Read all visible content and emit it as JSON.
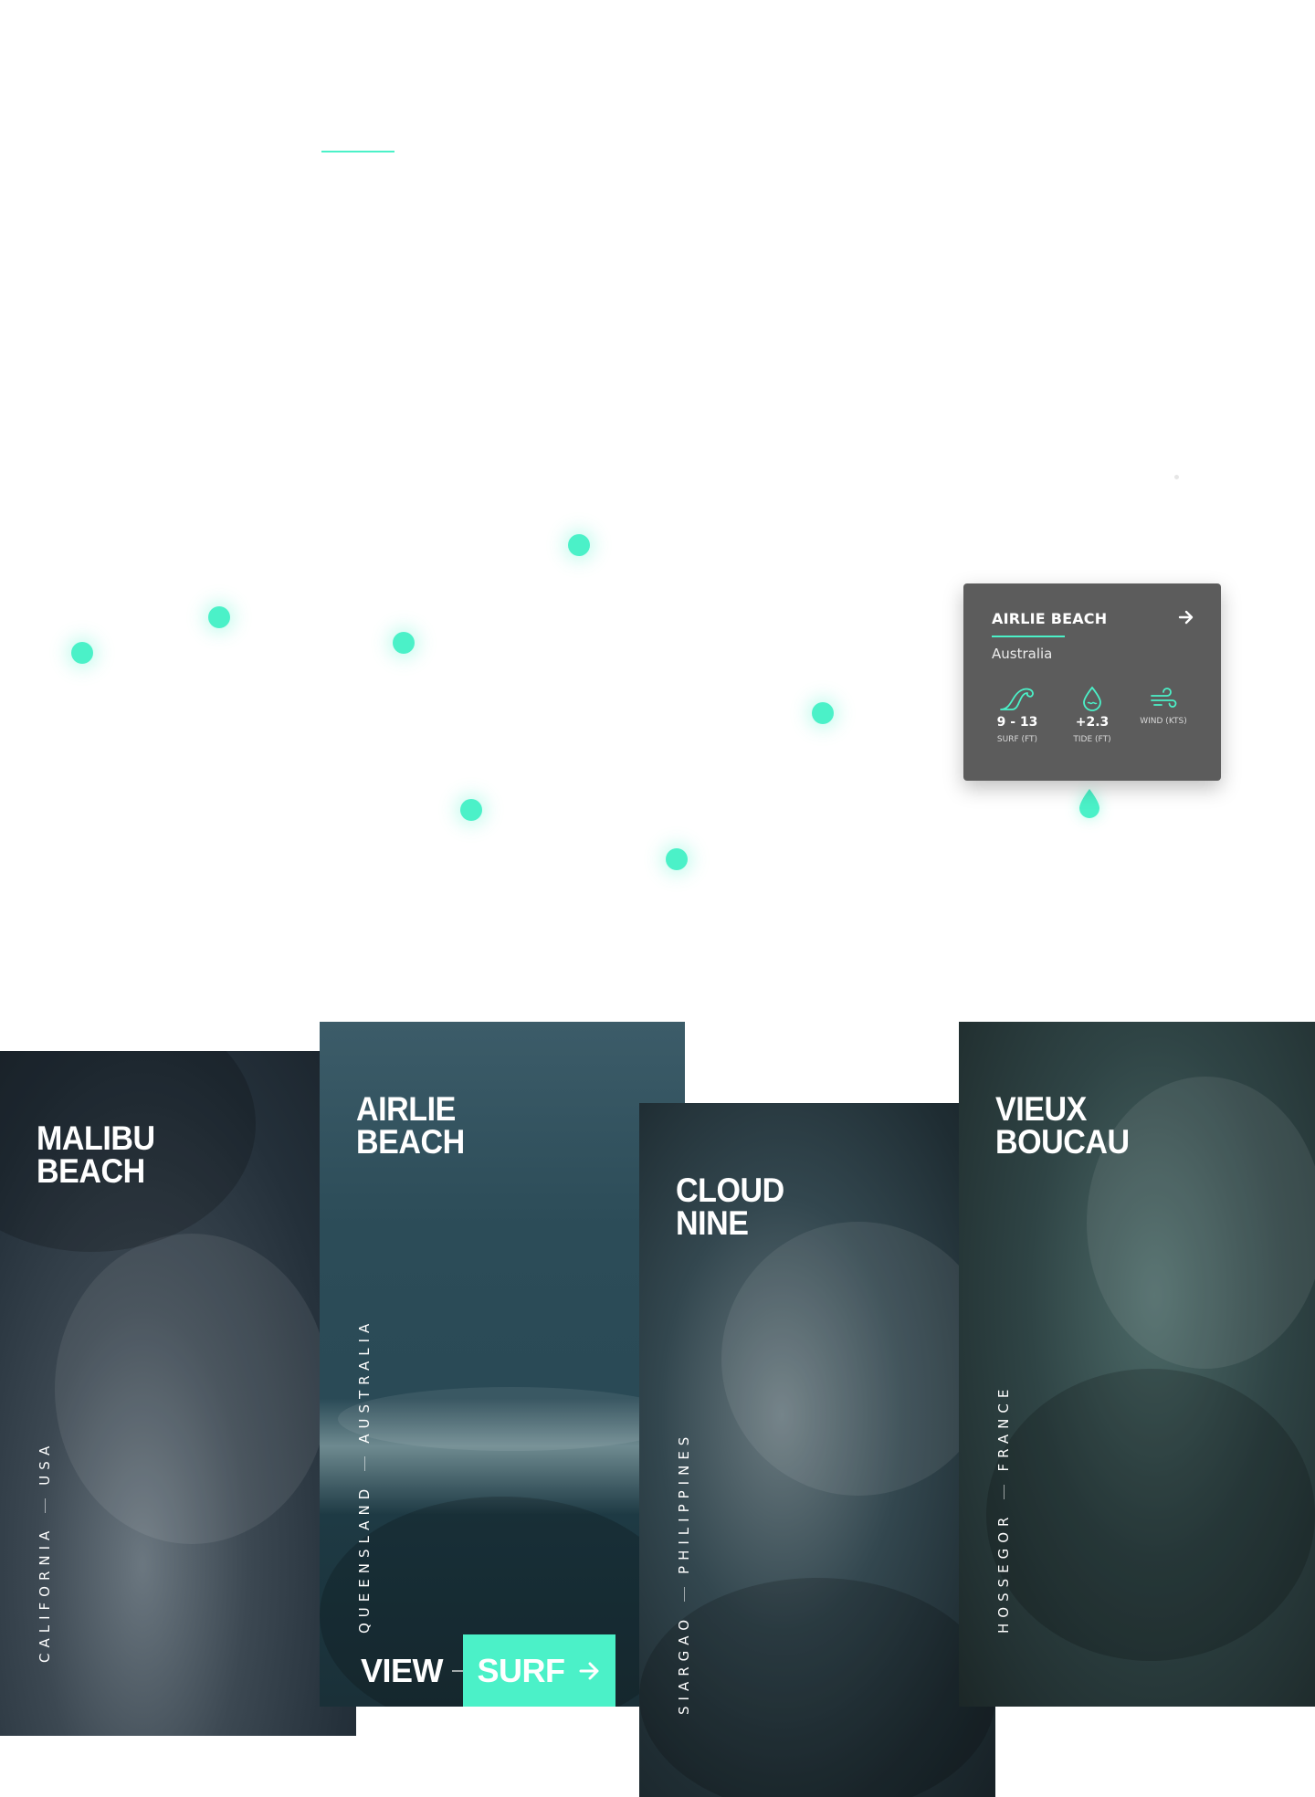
{
  "popup": {
    "title": "AIRLIE BEACH",
    "country": "Australia",
    "stats": [
      {
        "icon": "wave-icon",
        "value": "9 - 13",
        "label": "SURF (FT)"
      },
      {
        "icon": "water-drop-icon",
        "value": "+2.3",
        "label": "TIDE (FT)"
      },
      {
        "icon": "wind-icon",
        "value": "",
        "label": "WIND (KTS)"
      }
    ]
  },
  "map": {
    "dot_count": 8
  },
  "cards": [
    {
      "title_line1": "MALIBU",
      "title_line2": "BEACH",
      "region": "CALIFORNIA",
      "country": "USA"
    },
    {
      "title_line1": "AIRLIE",
      "title_line2": "BEACH",
      "region": "QUEENSLAND",
      "country": "AUSTRALIA"
    },
    {
      "title_line1": "CLOUD",
      "title_line2": "NINE",
      "region": "SIARGAO",
      "country": "PHILIPPINES"
    },
    {
      "title_line1": "VIEUX",
      "title_line2": "BOUCAU",
      "region": "HOSSEGOR",
      "country": "FRANCE"
    }
  ],
  "cta": {
    "view_label": "VIEW",
    "surf_label": "SURF"
  },
  "colors": {
    "accent": "#4bf1c8",
    "popup_bg": "#5c5c5c"
  }
}
